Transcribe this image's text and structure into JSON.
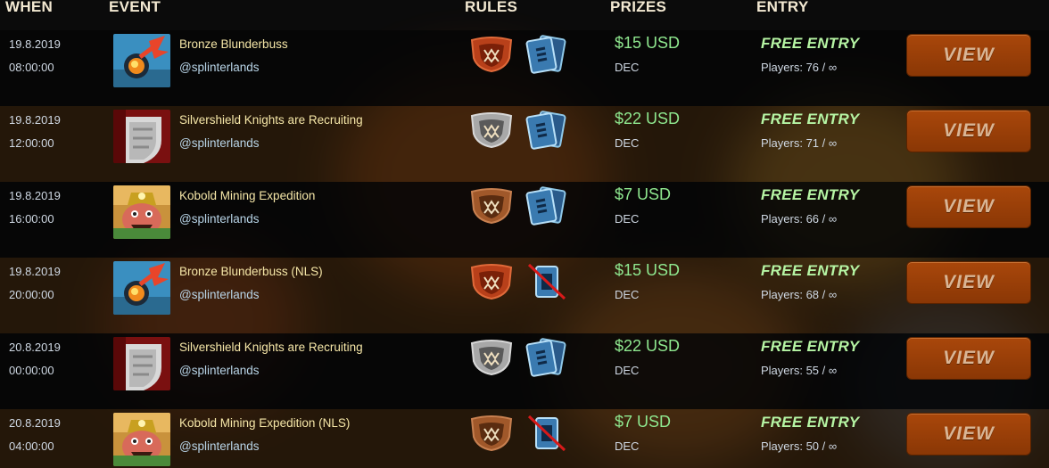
{
  "header": {
    "when": "WHEN",
    "event": "EVENT",
    "rules": "RULES",
    "prizes": "PRIZES",
    "entry": "ENTRY"
  },
  "rows": [
    {
      "date": "19.8.2019",
      "time": "08:00:00",
      "name": "Bronze Blunderbuss",
      "org": "@splinterlands",
      "thumb": "blunderbuss-icon",
      "shield": "bronze",
      "cards_allowed": true,
      "prize": "$15 USD",
      "currency": "DEC",
      "entry": "FREE ENTRY",
      "players": "Players: 76 / ∞",
      "button": "VIEW"
    },
    {
      "date": "19.8.2019",
      "time": "12:00:00",
      "name": "Silvershield Knights are Recruiting",
      "org": "@splinterlands",
      "thumb": "silver-shield-icon",
      "shield": "silver",
      "cards_allowed": true,
      "prize": "$22 USD",
      "currency": "DEC",
      "entry": "FREE ENTRY",
      "players": "Players: 71 / ∞",
      "button": "VIEW"
    },
    {
      "date": "19.8.2019",
      "time": "16:00:00",
      "name": "Kobold Mining Expedition",
      "org": "@splinterlands",
      "thumb": "kobold-miner-icon",
      "shield": "bronze-brown",
      "cards_allowed": true,
      "prize": "$7 USD",
      "currency": "DEC",
      "entry": "FREE ENTRY",
      "players": "Players: 66 / ∞",
      "button": "VIEW"
    },
    {
      "date": "19.8.2019",
      "time": "20:00:00",
      "name": "Bronze Blunderbuss (NLS)",
      "org": "@splinterlands",
      "thumb": "blunderbuss-icon",
      "shield": "bronze",
      "cards_allowed": false,
      "prize": "$15 USD",
      "currency": "DEC",
      "entry": "FREE ENTRY",
      "players": "Players: 68 / ∞",
      "button": "VIEW"
    },
    {
      "date": "20.8.2019",
      "time": "00:00:00",
      "name": "Silvershield Knights are Recruiting",
      "org": "@splinterlands",
      "thumb": "silver-shield-icon",
      "shield": "silver",
      "cards_allowed": true,
      "prize": "$22 USD",
      "currency": "DEC",
      "entry": "FREE ENTRY",
      "players": "Players: 55 / ∞",
      "button": "VIEW"
    },
    {
      "date": "20.8.2019",
      "time": "04:00:00",
      "name": "Kobold Mining Expedition (NLS)",
      "org": "@splinterlands",
      "thumb": "kobold-miner-icon",
      "shield": "bronze-brown",
      "cards_allowed": false,
      "prize": "$7 USD",
      "currency": "DEC",
      "entry": "FREE ENTRY",
      "players": "Players: 50 / ∞",
      "button": "VIEW"
    }
  ],
  "colors": {
    "accent_button": "#a9470b",
    "prize_green": "#8fe88f",
    "free_entry": "#b6f5a4",
    "event_name": "#f6e7a8"
  }
}
